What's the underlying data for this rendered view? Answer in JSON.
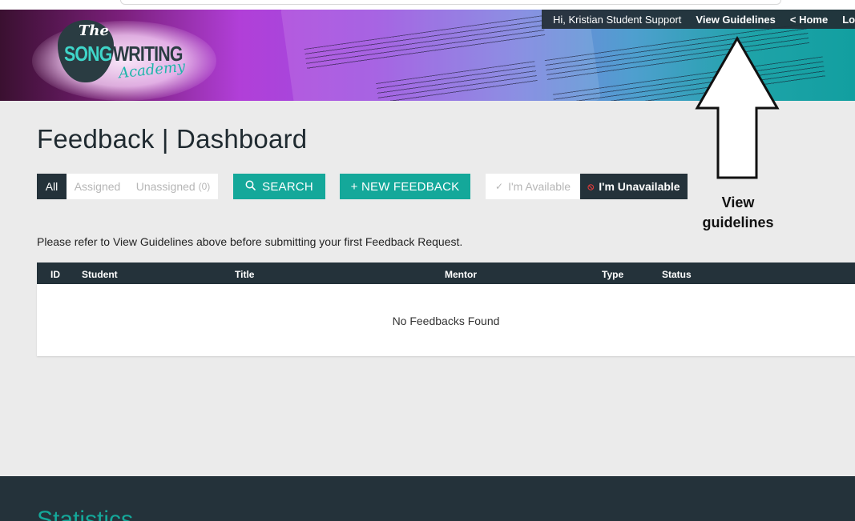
{
  "header": {
    "logo": {
      "the": "The",
      "song": "SONG",
      "writing": "WRITING",
      "academy": "Academy"
    },
    "nav": {
      "greeting": "Hi, Kristian Student Support",
      "view_guidelines": "View Guidelines",
      "home": "< Home",
      "logout": "Logout"
    }
  },
  "page": {
    "title": "Feedback | Dashboard"
  },
  "toolbar": {
    "filters": [
      {
        "label": "All",
        "active": true
      },
      {
        "label": "Assigned",
        "active": false
      },
      {
        "label": "Unassigned",
        "count": "(0)",
        "active": false
      }
    ],
    "search_label": "SEARCH",
    "new_feedback_label": "+ NEW FEEDBACK",
    "availability": {
      "available_label": "I'm Available",
      "unavailable_label": "I'm Unavailable",
      "selected": "unavailable"
    }
  },
  "notice": "Please refer to View Guidelines above before submitting your first Feedback Request.",
  "table": {
    "columns": [
      "ID",
      "Student",
      "Title",
      "Mentor",
      "Type",
      "Status"
    ],
    "empty_text": "No Feedbacks Found"
  },
  "annotation": {
    "line1": "View",
    "line2": "guidelines"
  },
  "footer": {
    "heading": "Statistics"
  },
  "colors": {
    "accent": "#14a89a",
    "dark": "#24323a",
    "danger": "#e23b3b"
  },
  "icons": {
    "search": "search-icon",
    "check": "check-icon",
    "unavailable": "no-entry-icon",
    "arrow": "up-arrow-icon"
  }
}
